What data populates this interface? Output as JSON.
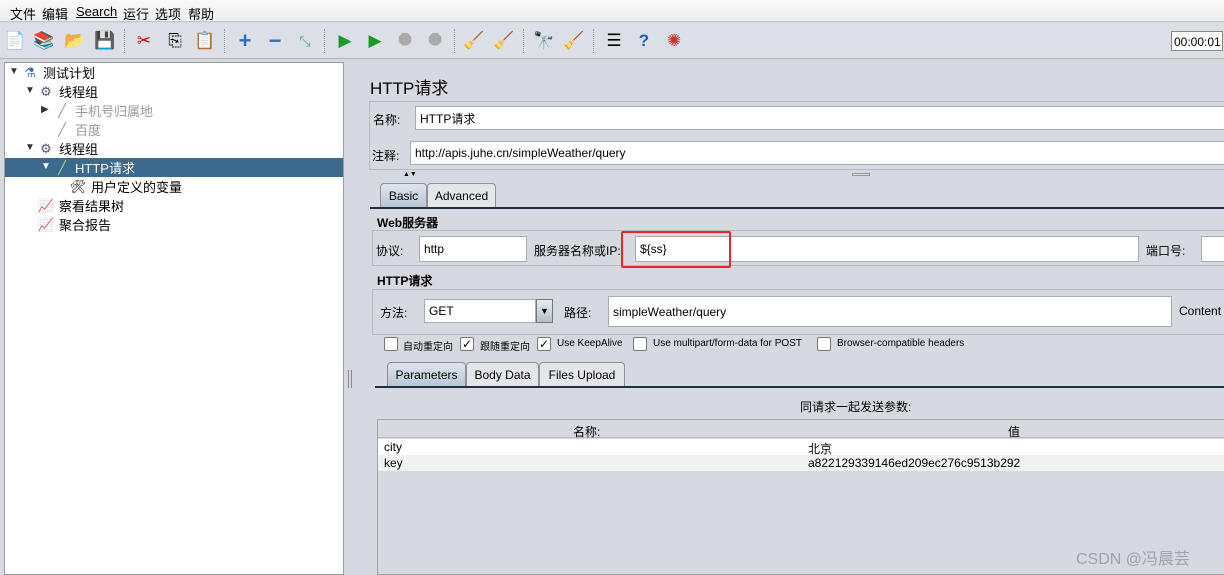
{
  "menu": [
    "文件",
    "编辑",
    "Search",
    "运行",
    "选项",
    "帮助"
  ],
  "toolbar": {
    "icons": [
      "new-icon",
      "templates-icon",
      "open-icon",
      "save-icon",
      "cut-icon",
      "copy-icon",
      "paste-icon",
      "expand-icon",
      "collapse-icon",
      "toggle-icon",
      "start-icon",
      "start-no-pause-icon",
      "stop-icon",
      "shutdown-icon",
      "clear-icon",
      "clear-all-icon",
      "search-icon",
      "reset-search-icon",
      "function-helper-icon",
      "help-icon",
      "remote-icon"
    ],
    "timer": "00:00:01"
  },
  "tree": [
    {
      "label": "测试计划",
      "icon": "test-plan-icon",
      "expanded": true
    },
    {
      "label": "线程组",
      "icon": "thread-group-icon",
      "expanded": true
    },
    {
      "label": "手机号归属地",
      "icon": "sampler-icon",
      "disabled": true
    },
    {
      "label": "百度",
      "icon": "sampler-icon",
      "disabled": true
    },
    {
      "label": "线程组",
      "icon": "thread-group-icon",
      "expanded": true
    },
    {
      "label": "HTTP请求",
      "icon": "sampler-icon",
      "selected": true
    },
    {
      "label": "用户定义的变量",
      "icon": "config-icon"
    },
    {
      "label": "察看结果树",
      "icon": "listener-icon"
    },
    {
      "label": "聚合报告",
      "icon": "listener-icon"
    }
  ],
  "panel": {
    "title": "HTTP请求",
    "name_label": "名称:",
    "name_value": "HTTP请求",
    "comment_label": "注释:",
    "comment_value": "http://apis.juhe.cn/simpleWeather/query",
    "tabs": [
      "Basic",
      "Advanced"
    ],
    "web_server_title": "Web服务器",
    "protocol_label": "协议:",
    "protocol_value": "http",
    "server_label": "服务器名称或IP:",
    "server_value": "${ss}",
    "port_label": "端口号:",
    "port_value": "",
    "http_title": "HTTP请求",
    "method_label": "方法:",
    "method_value": "GET",
    "path_label": "路径:",
    "path_value": "simpleWeather/query",
    "content_label": "Content",
    "checkboxes": [
      {
        "label": "自动重定向",
        "checked": false
      },
      {
        "label": "跟随重定向",
        "checked": true
      },
      {
        "label": "Use KeepAlive",
        "checked": true
      },
      {
        "label": "Use multipart/form-data for POST",
        "checked": false
      },
      {
        "label": "Browser-compatible headers",
        "checked": false
      }
    ],
    "subtabs": [
      "Parameters",
      "Body Data",
      "Files Upload"
    ],
    "params_caption": "同请求一起发送参数:",
    "params_headers": [
      "名称:",
      "值"
    ],
    "params_rows": [
      [
        "city",
        "北京"
      ],
      [
        "key",
        "a822129339146ed209ec276c9513b292"
      ]
    ]
  },
  "highlight_color": "#e8262a",
  "watermark": "CSDN @冯晨芸"
}
